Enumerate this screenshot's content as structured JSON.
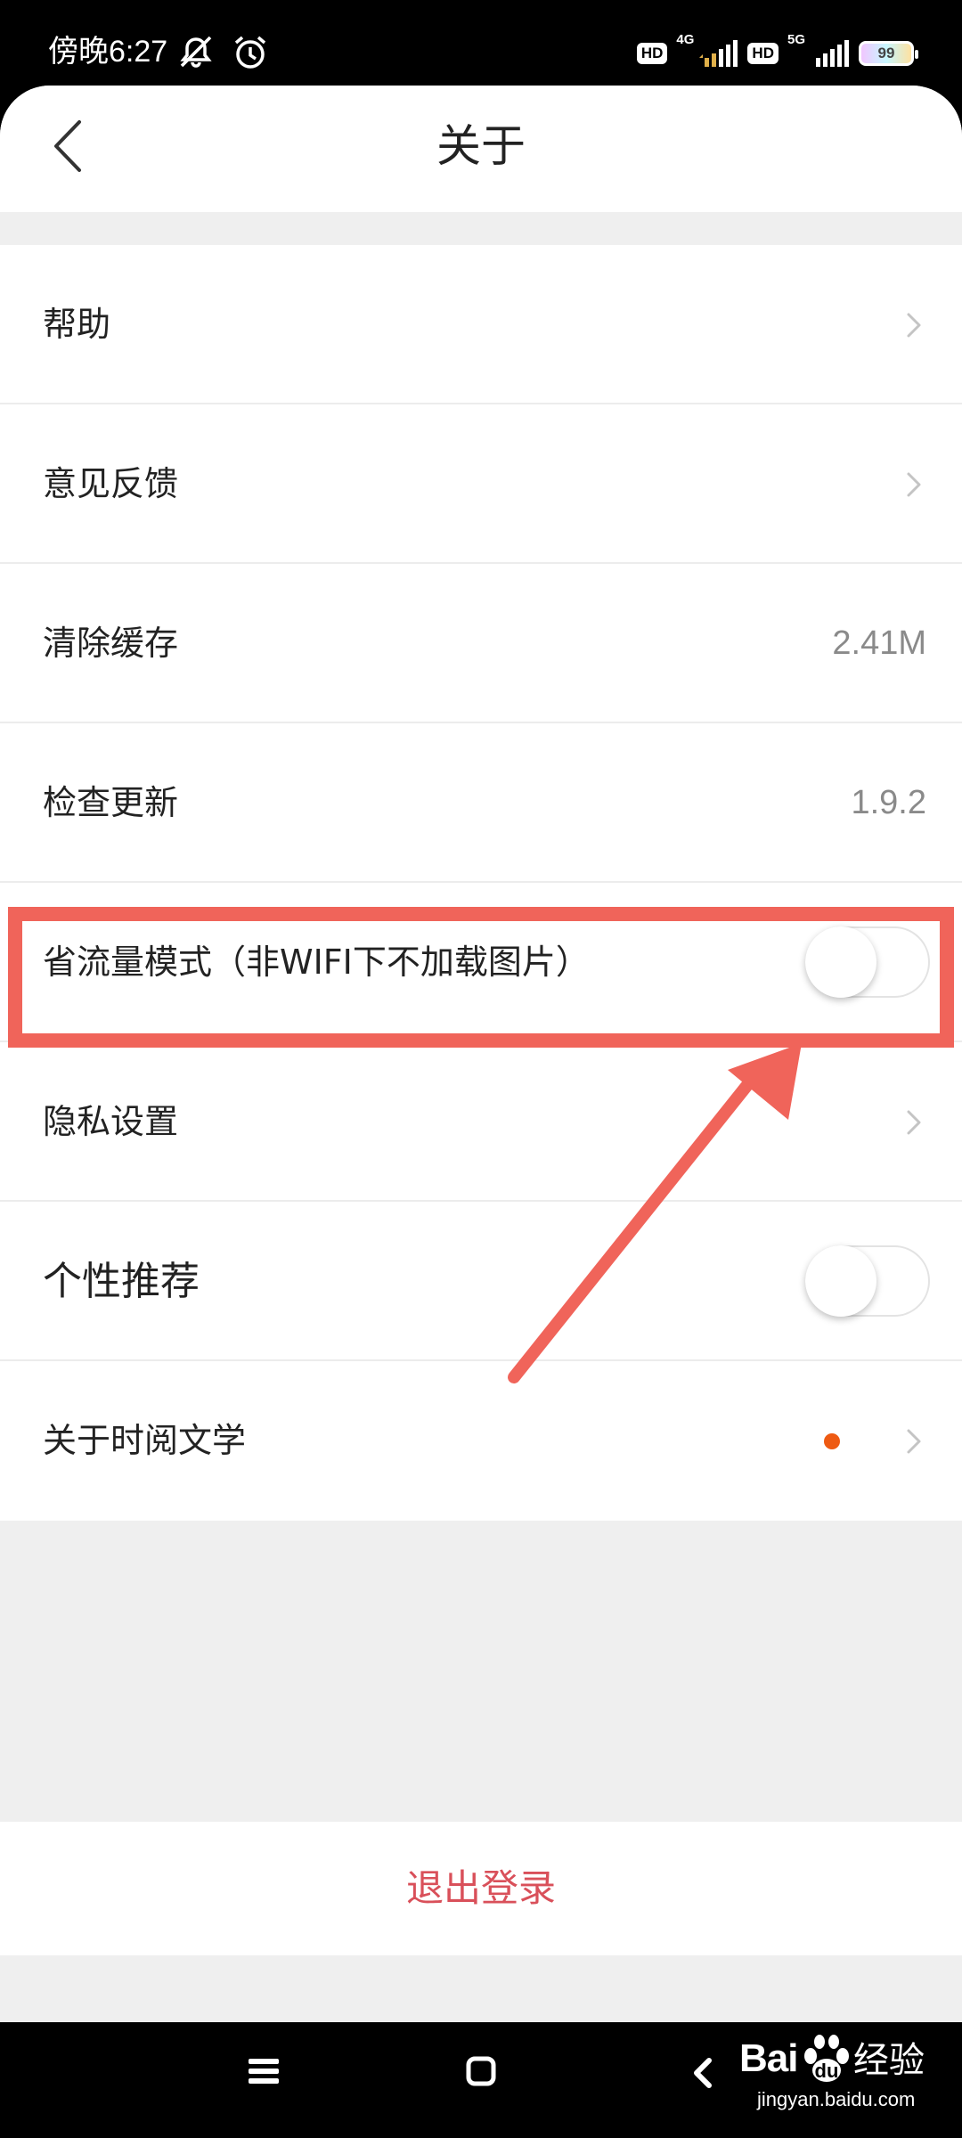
{
  "status_bar": {
    "time": "傍晚6:27",
    "hd_label": "HD",
    "net1": "4G",
    "net2": "5G",
    "battery_level": "99"
  },
  "header": {
    "title": "关于",
    "back_icon": "chevron-left-icon"
  },
  "rows": [
    {
      "label": "帮助",
      "type": "link"
    },
    {
      "label": "意见反馈",
      "type": "link"
    },
    {
      "label": "清除缓存",
      "type": "value",
      "value": "2.41M"
    },
    {
      "label": "检查更新",
      "type": "value",
      "value": "1.9.2"
    },
    {
      "label": "省流量模式（非WIFI下不加载图片）",
      "type": "toggle",
      "on": false
    },
    {
      "label": "隐私设置",
      "type": "link"
    },
    {
      "label": "个性推荐",
      "type": "toggle",
      "on": false
    },
    {
      "label": "关于时阅文学",
      "type": "link",
      "badge_dot": true
    }
  ],
  "logout_label": "退出登录",
  "watermark": {
    "brand": "Bai",
    "brand_suffix": "经验",
    "url": "jingyan.baidu.com"
  },
  "colors": {
    "accent_red": "#d9505a",
    "highlight": "#f0645a",
    "dot": "#ee5a12"
  }
}
